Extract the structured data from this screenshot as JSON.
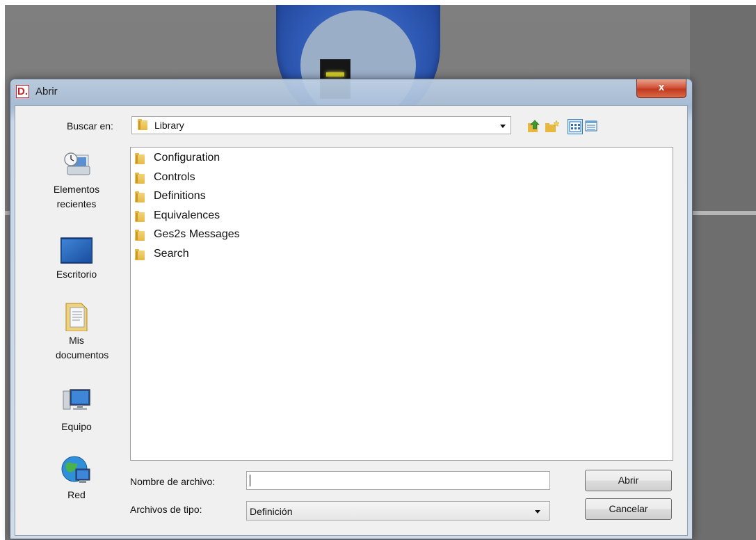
{
  "window": {
    "title": "Abrir",
    "app_icon_letter": "D.",
    "close_symbol": "x"
  },
  "lookin": {
    "label": "Buscar en:",
    "value": "Library"
  },
  "toolbar": {
    "icons": [
      "up-folder-icon",
      "new-folder-icon",
      "list-view-icon",
      "details-view-icon"
    ]
  },
  "places": [
    {
      "label": "Elementos recientes",
      "icon": "recent-items-icon"
    },
    {
      "label": "Escritorio",
      "icon": "desktop-icon"
    },
    {
      "label": "Mis documentos",
      "icon": "documents-icon"
    },
    {
      "label": "Equipo",
      "icon": "computer-icon"
    },
    {
      "label": "Red",
      "icon": "network-icon"
    }
  ],
  "files": [
    {
      "name": "Configuration",
      "type": "folder"
    },
    {
      "name": "Controls",
      "type": "folder"
    },
    {
      "name": "Definitions",
      "type": "folder"
    },
    {
      "name": "Equivalences",
      "type": "folder"
    },
    {
      "name": "Ges2s Messages",
      "type": "folder"
    },
    {
      "name": "Search",
      "type": "folder"
    }
  ],
  "filename": {
    "label": "Nombre de archivo:",
    "value": ""
  },
  "filetype": {
    "label": "Archivos de tipo:",
    "value": "Definición"
  },
  "buttons": {
    "open": "Abrir",
    "cancel": "Cancelar"
  },
  "colors": {
    "title_bar": "#b9cde3",
    "close_button": "#c8462a",
    "folder": "#e6b944",
    "selected_view": "#d5e8f7"
  }
}
